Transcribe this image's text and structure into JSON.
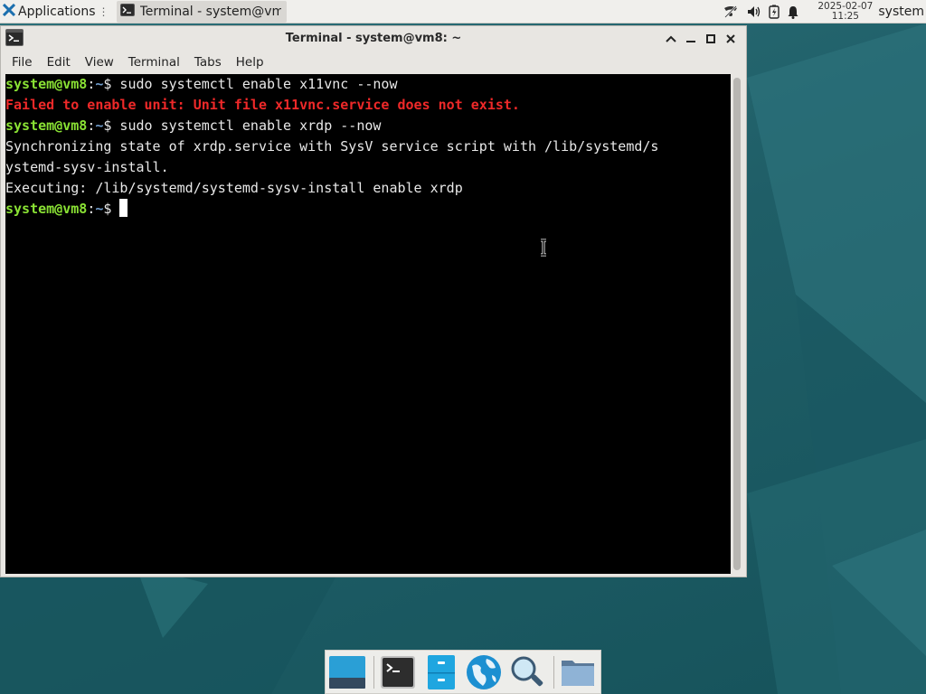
{
  "top_panel": {
    "applications_label": "Applications",
    "task_label": "Terminal - system@vm...",
    "clock_date": "2025-02-07",
    "clock_time": "11:25",
    "user": "system",
    "tray_icons": [
      "network-icon",
      "volume-icon",
      "battery-icon",
      "notifications-icon"
    ]
  },
  "window": {
    "title": "Terminal - system@vm8: ~",
    "menu": [
      "File",
      "Edit",
      "View",
      "Terminal",
      "Tabs",
      "Help"
    ]
  },
  "terminal": {
    "lines": [
      {
        "type": "prompt",
        "user": "system@vm8",
        "path": "~",
        "cmd": " sudo systemctl enable x11vnc --now"
      },
      {
        "type": "error",
        "text": "Failed to enable unit: Unit file x11vnc.service does not exist."
      },
      {
        "type": "prompt",
        "user": "system@vm8",
        "path": "~",
        "cmd": " sudo systemctl enable xrdp --now"
      },
      {
        "type": "output",
        "text": "Synchronizing state of xrdp.service with SysV service script with /lib/systemd/s"
      },
      {
        "type": "output",
        "text": "ystemd-sysv-install."
      },
      {
        "type": "output",
        "text": "Executing: /lib/systemd/systemd-sysv-install enable xrdp"
      },
      {
        "type": "prompt",
        "user": "system@vm8",
        "path": "~",
        "cmd": " ",
        "cursor": true
      }
    ]
  },
  "dock": {
    "items": [
      "show-desktop",
      "terminal",
      "file-manager",
      "web-browser",
      "app-finder",
      "home-folder"
    ]
  }
}
